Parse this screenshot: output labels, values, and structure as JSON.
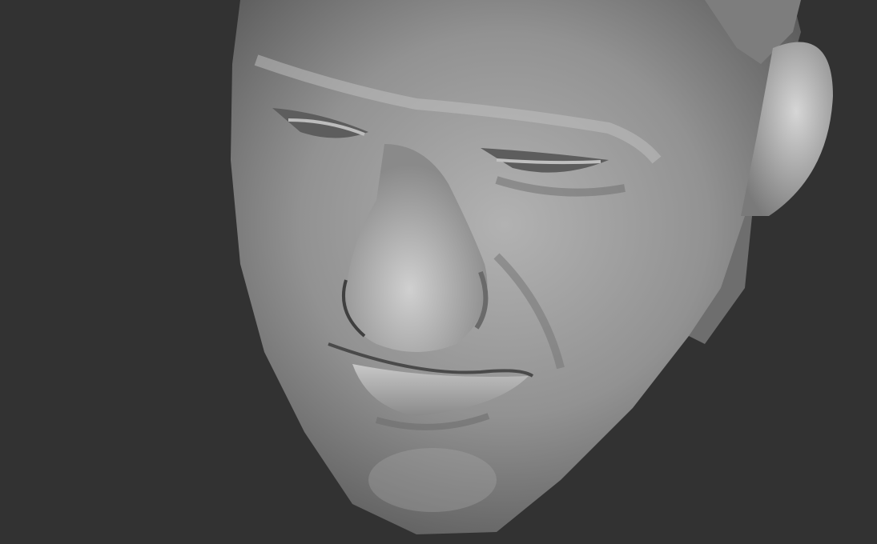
{
  "scene": {
    "subject": "sculpted-head",
    "colors": {
      "background": "#323232",
      "clay_light": "#c4c4c4",
      "clay_mid": "#8e8e8e",
      "clay_dark": "#4a4a4a"
    }
  }
}
